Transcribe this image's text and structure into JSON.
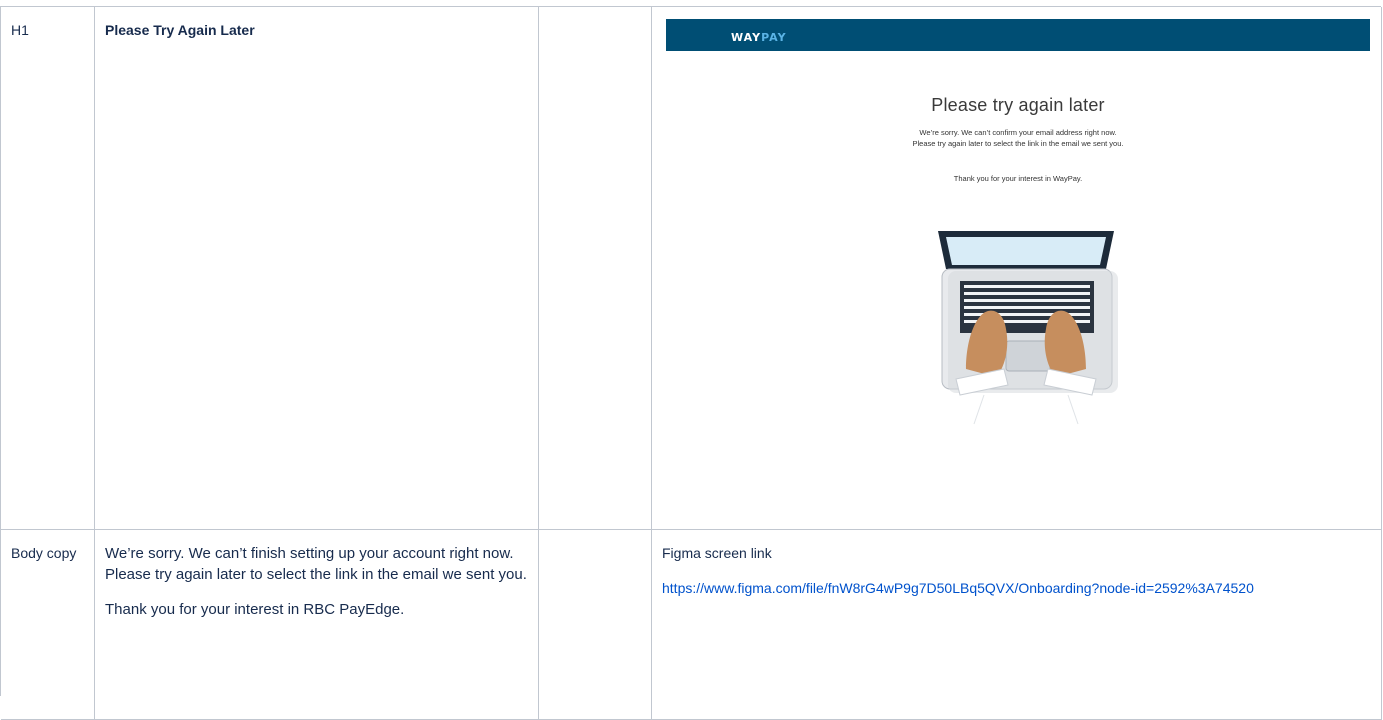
{
  "rows": [
    {
      "label": "H1",
      "content": "Please Try Again Later"
    },
    {
      "label": "Body copy",
      "paragraphs": [
        "We’re sorry. We can’t finish setting up your account right now. Please try again later to select the link in the email we sent you.",
        "Thank you for your interest in RBC PayEdge."
      ],
      "notes_title": "Figma screen link",
      "link": "https://www.figma.com/file/fnW8rG4wP9g7D50LBq5QVX/Onboarding?node-id=2592%3A74520"
    }
  ],
  "mockup": {
    "logo_way": "WAY",
    "logo_pay": "PAY",
    "title": "Please try again later",
    "body_line1": "We’re sorry. We can’t confirm your email address right now.",
    "body_line2": "Please try again later to select the link in the email we sent you.",
    "thanks": "Thank you for your interest in WayPay.",
    "colors": {
      "header": "#004e74",
      "link": "#0052cc",
      "skin": "#c68e5e"
    }
  }
}
